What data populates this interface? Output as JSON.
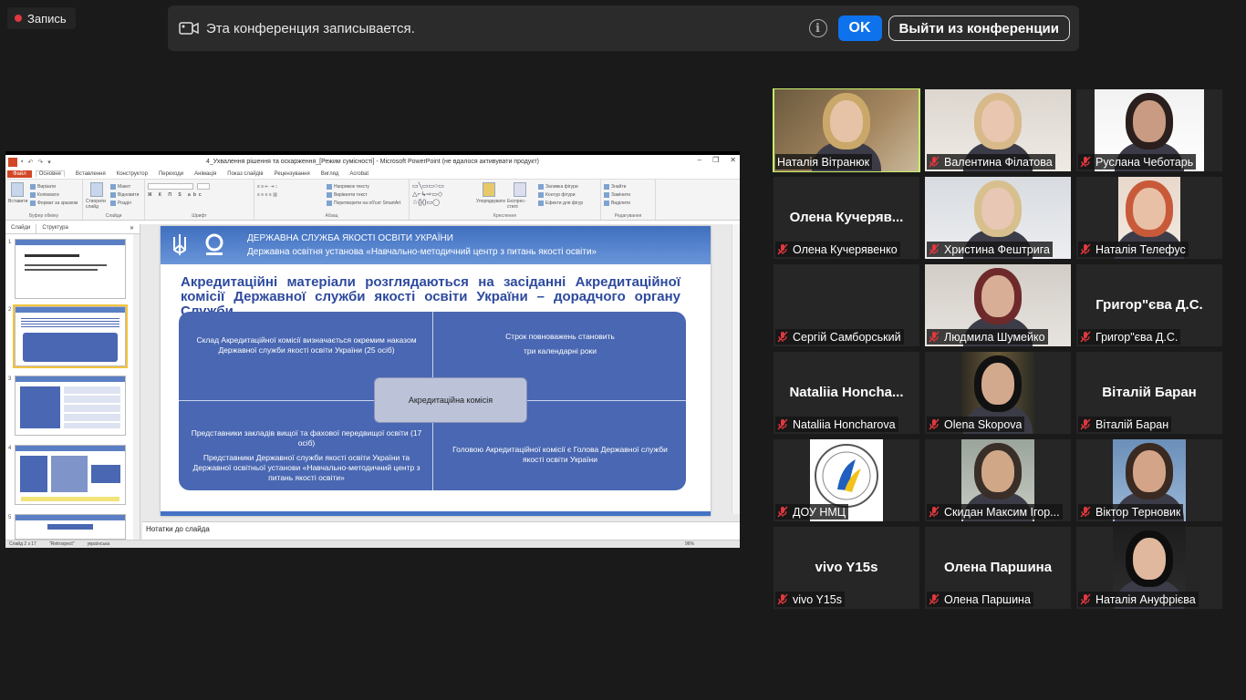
{
  "recording": {
    "label": "Запись"
  },
  "banner": {
    "message": "Эта конференция записывается.",
    "ok_label": "OK",
    "leave_label": "Выйти из конференции"
  },
  "ppt": {
    "window_title": "4_Ухвалення рішення та оскарження_[Режим сумісності] - Microsoft PowerPoint (не вдалося активувати продукт)",
    "tabs": [
      "Файл",
      "Основне",
      "Вставлення",
      "Конструктор",
      "Переходи",
      "Анімація",
      "Показ слайдів",
      "Рецензування",
      "Вигляд",
      "Acrobat"
    ],
    "ribbon": {
      "clipboard": {
        "paste": "Вставити",
        "cut": "Вирізати",
        "copy": "Копіювати",
        "format": "Формат за зразком",
        "label": "Буфер обміну"
      },
      "slides": {
        "new": "Створити слайд",
        "layout": "Макет",
        "reset": "Відновити",
        "section": "Розділ",
        "label": "Слайди"
      },
      "font": {
        "label": "Шрифт"
      },
      "paragraph": {
        "dir": "Напрямок тексту",
        "align": "Вирівняти текст",
        "smartart": "Перетворити на об'єкт SmartArt",
        "label": "Абзац"
      },
      "drawing": {
        "arrange": "Упорядкувати",
        "styles": "Експрес-стилі",
        "fill": "Заливка фігури",
        "outline": "Контур фігури",
        "effects": "Ефекти для фігур",
        "label": "Креслення"
      },
      "editing": {
        "find": "Знайти",
        "replace": "Замінити",
        "select": "Виділити",
        "label": "Редагування"
      }
    },
    "panel_tabs": [
      "Слайди",
      "Структура"
    ],
    "slide": {
      "header_line1": "ДЕРЖАВНА СЛУЖБА ЯКОСТІ ОСВІТИ УКРАЇНИ",
      "header_line2": "Державна освітня установа «Навчально-методичний центр з питань якості освіти»",
      "title": "Акредитаційні матеріали розглядаються на засіданні Акредитаційної комісії Державної служби якості освіти України – дорадчого органу Служби",
      "q1": "Склад Акредитаційної комісії визначається окремим наказом Державної служби якості освіти України (25 осіб)",
      "q2a": "Строк повноважень становить",
      "q2b": "три календарні роки",
      "q3a": "Представники закладів вищої та фахової передвищої освіти (17 осіб)",
      "q3b": "Представники Державної служби якості освіти України та Державної освітньої установи «Навчально-методичний центр з питань якості освіти»",
      "q4": "Головою Акредитаційної комісії є Голова Державної служби якості освіти України",
      "center": "Акредитаційна комісія"
    },
    "thumb_numbers": [
      "1",
      "2",
      "3",
      "4",
      "5"
    ],
    "notes": "Нотатки до слайда",
    "status": {
      "slide": "Слайд 2 з 17",
      "theme": "\"Retrospect\"",
      "lang": "українська",
      "zoom": "96%"
    }
  },
  "participants": [
    {
      "name": "Наталія Вітранюк",
      "video": true,
      "muted": false,
      "speaking": true
    },
    {
      "name": "Валентина Філатова",
      "video": true,
      "muted": true
    },
    {
      "name": "Руслана Чеботарь",
      "video": true,
      "muted": true
    },
    {
      "name": "Олена Кучерявенко",
      "display": "Олена  Кучеряв...",
      "video": false,
      "muted": true
    },
    {
      "name": "Христина Фештрига",
      "video": true,
      "muted": true
    },
    {
      "name": "Наталія Телефус",
      "video": true,
      "muted": true
    },
    {
      "name": "Сергій Самборський",
      "video": false,
      "muted": true
    },
    {
      "name": "Людмила Шумейко",
      "video": true,
      "muted": true
    },
    {
      "name": "Григор\"єва Д.С.",
      "display": "Григор\"єва Д.С.",
      "video": false,
      "muted": true
    },
    {
      "name": "Nataliia Honcharova",
      "display": "Nataliia  Honcha...",
      "video": false,
      "muted": true
    },
    {
      "name": "Olena Skopova",
      "video": true,
      "muted": true
    },
    {
      "name": "Віталій Баран",
      "display": "Віталій Баран",
      "video": false,
      "muted": true
    },
    {
      "name": "ДОУ НМЦ",
      "video": true,
      "muted": true
    },
    {
      "name": "Скидан Максим Ігор...",
      "video": true,
      "muted": true
    },
    {
      "name": "Віктор Терновик",
      "video": true,
      "muted": true
    },
    {
      "name": "vivo Y15s",
      "display": "vivo Y15s",
      "video": false,
      "muted": true
    },
    {
      "name": "Олена Паршина",
      "display": "Олена Паршина",
      "video": false,
      "muted": true
    },
    {
      "name": "Наталія Ануфрієва",
      "video": true,
      "muted": true
    }
  ],
  "colors": {
    "speaking": "#c7ef6b",
    "ok": "#0e72ed",
    "muted": "#e0383e",
    "slide_blue": "#4967b2"
  }
}
